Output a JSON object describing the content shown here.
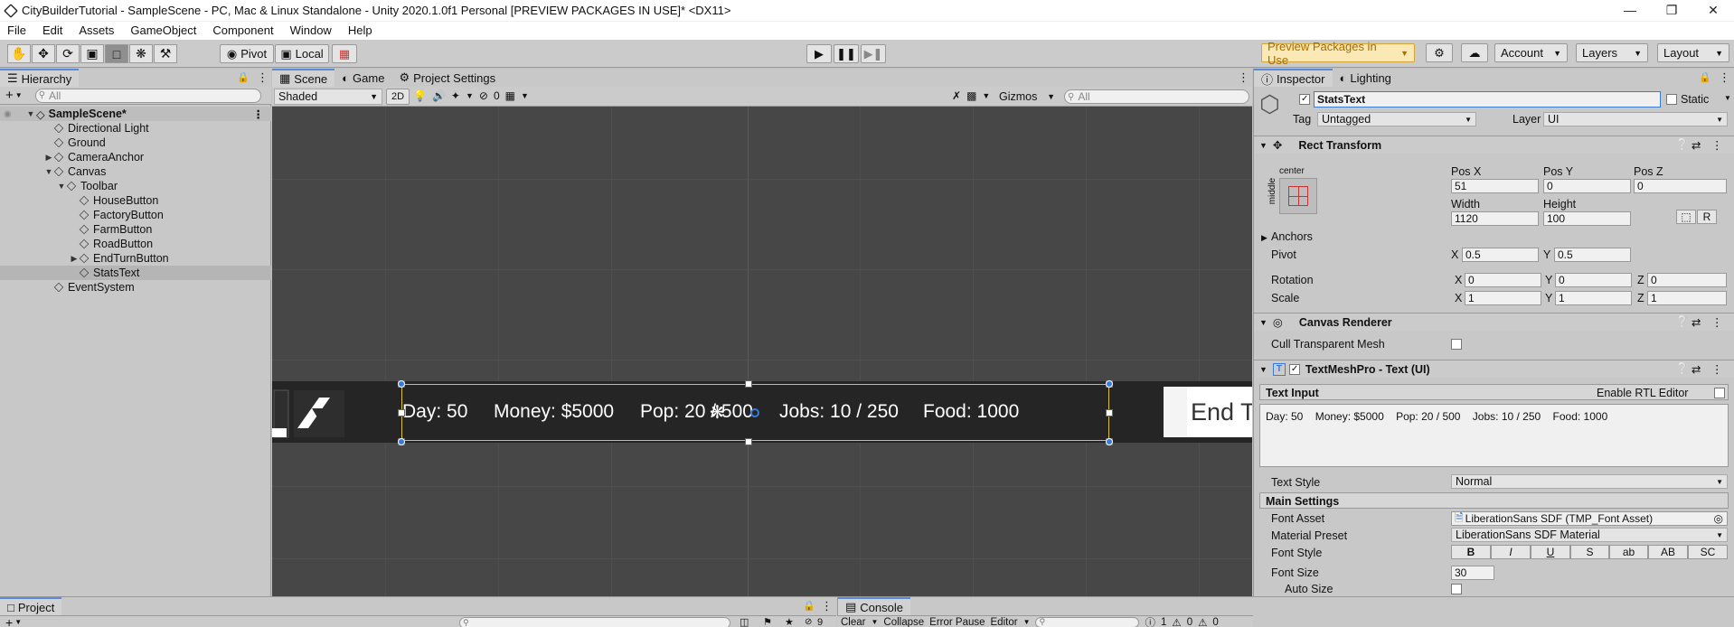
{
  "window": {
    "title": "CityBuilderTutorial - SampleScene - PC, Mac & Linux Standalone - Unity 2020.1.0f1 Personal [PREVIEW PACKAGES IN USE]* <DX11>"
  },
  "menu": [
    "File",
    "Edit",
    "Assets",
    "GameObject",
    "Component",
    "Window",
    "Help"
  ],
  "toolbar": {
    "pivot": "Pivot",
    "local": "Local",
    "preview": "Preview Packages in Use",
    "account": "Account",
    "layers": "Layers",
    "layout": "Layout"
  },
  "hierarchy": {
    "tab": "Hierarchy",
    "search_placeholder": "All",
    "scene": "SampleScene*",
    "items": [
      {
        "label": "Directional Light"
      },
      {
        "label": "Ground"
      },
      {
        "label": "CameraAnchor"
      },
      {
        "label": "Canvas"
      },
      {
        "label": "Toolbar"
      },
      {
        "label": "HouseButton"
      },
      {
        "label": "FactoryButton"
      },
      {
        "label": "FarmButton"
      },
      {
        "label": "RoadButton"
      },
      {
        "label": "EndTurnButton"
      },
      {
        "label": "StatsText"
      },
      {
        "label": "EventSystem"
      }
    ]
  },
  "scene": {
    "tabs": [
      "Scene",
      "Game",
      "Project Settings"
    ],
    "shading": "Shaded",
    "mode2d": "2D",
    "hidden_count": "0",
    "gizmos": "Gizmos",
    "search_placeholder": "All",
    "stats_day": "Day: 50",
    "stats_money": "Money: $5000",
    "stats_pop": "Pop: 20 / 500",
    "stats_jobs": "Jobs: 10 / 250",
    "stats_food": "Food: 1000",
    "end_turn": "End T"
  },
  "inspector": {
    "tabs": [
      "Inspector",
      "Lighting"
    ],
    "object_name": "StatsText",
    "static": "Static",
    "tag_label": "Tag",
    "tag": "Untagged",
    "layer_label": "Layer",
    "layer": "UI",
    "rect": {
      "title": "Rect Transform",
      "anchor_h": "center",
      "anchor_v": "middle",
      "posx_label": "Pos X",
      "posy_label": "Pos Y",
      "posz_label": "Pos Z",
      "posx": "51",
      "posy": "0",
      "posz": "0",
      "width_label": "Width",
      "height_label": "Height",
      "width": "1120",
      "height": "100",
      "anchors": "Anchors",
      "pivot": "Pivot",
      "pivot_x": "0.5",
      "pivot_y": "0.5",
      "rotation": "Rotation",
      "rot_x": "0",
      "rot_y": "0",
      "rot_z": "0",
      "scale": "Scale",
      "scale_x": "1",
      "scale_y": "1",
      "scale_z": "1",
      "r": "R"
    },
    "canvas_renderer": {
      "title": "Canvas Renderer",
      "cull": "Cull Transparent Mesh"
    },
    "tmp": {
      "title": "TextMeshPro - Text (UI)",
      "text_input": "Text Input",
      "rtl": "Enable RTL Editor",
      "text": "Day: 50    Money: $5000    Pop: 20 / 500    Jobs: 10 / 250    Food: 1000",
      "text_style_label": "Text Style",
      "text_style": "Normal",
      "main_settings": "Main Settings",
      "font_asset_label": "Font Asset",
      "font_asset": "LiberationSans SDF (TMP_Font Asset)",
      "material_label": "Material Preset",
      "material": "LiberationSans SDF Material",
      "font_style_label": "Font Style",
      "styles": [
        "B",
        "I",
        "U",
        "S",
        "ab",
        "AB",
        "SC"
      ],
      "font_size_label": "Font Size",
      "font_size": "30",
      "auto_size": "Auto Size"
    }
  },
  "bottom": {
    "project": "Project",
    "console": "Console",
    "clear": "Clear",
    "collapse": "Collapse",
    "error_pause": "Error Pause",
    "editor": "Editor",
    "hidden": "9",
    "c1": "1",
    "c2": "0",
    "c3": "0"
  }
}
